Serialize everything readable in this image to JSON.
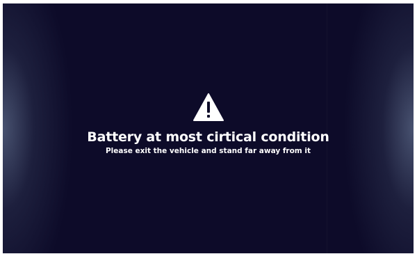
{
  "alert": {
    "icon": "warning-triangle-icon",
    "title": "Battery at most cirtical condition",
    "message": "Please exit the vehicle and stand far away from it"
  },
  "colors": {
    "background": "#0d0b29",
    "text": "#ffffff",
    "icon": "#ffffff",
    "icon_mark": "#0d0b29"
  }
}
